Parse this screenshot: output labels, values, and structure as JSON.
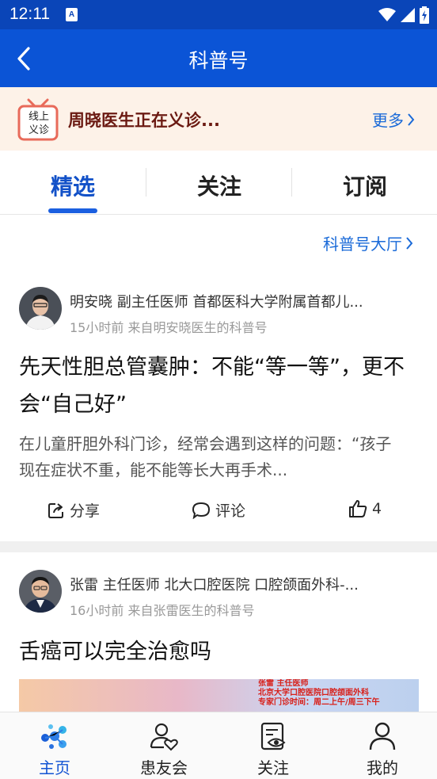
{
  "status_bar": {
    "time": "12:11",
    "notif_glyph": "A"
  },
  "app_bar": {
    "title": "科普号"
  },
  "banner": {
    "icon_label": "线上义诊",
    "text": "周晓医生正在义诊...",
    "more": "更多"
  },
  "tabs": [
    {
      "label": "精选",
      "active": true
    },
    {
      "label": "关注",
      "active": false
    },
    {
      "label": "订阅",
      "active": false
    }
  ],
  "hall_link": "科普号大厅",
  "articles": [
    {
      "author": "明安晓 副主任医师 首都医科大学附属首都儿...",
      "meta": "15小时前  来自明安晓医生的科普号",
      "title": "先天性胆总管囊肿：不能“等一等”，更不会“自己好”",
      "summary": "在儿童肝胆外科门诊，经常会遇到这样的问题：“孩子现在症状不重，能不能等长大再手术...",
      "actions": {
        "share": "分享",
        "comment": "评论",
        "likes": "4"
      }
    },
    {
      "author": "张雷 主任医师 北大口腔医院 口腔颌面外科-...",
      "meta": "16小时前  来自张雷医生的科普号",
      "title": "舌癌可以完全治愈吗",
      "thumb_lines": [
        "张雷  主任医师",
        "北京大学口腔医院口腔颌面外科",
        "专家门诊时间：周二上午/周三下午"
      ]
    }
  ],
  "bottom_nav": [
    {
      "label": "主页",
      "icon": "home-logo-icon",
      "active": true
    },
    {
      "label": "患友会",
      "icon": "patient-group-icon",
      "active": false
    },
    {
      "label": "关注",
      "icon": "follow-eye-icon",
      "active": false
    },
    {
      "label": "我的",
      "icon": "profile-icon",
      "active": false
    }
  ],
  "colors": {
    "primary": "#0b54d6",
    "status_bar": "#0a45b8",
    "banner_bg": "#fdf2e8",
    "banner_text": "#6b1a12",
    "link": "#1a6ad8"
  }
}
